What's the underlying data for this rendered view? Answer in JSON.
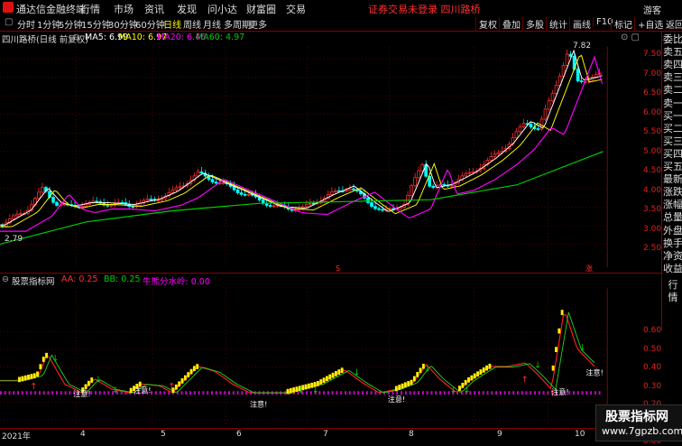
{
  "app": {
    "name": "通达信金融终端",
    "menu": [
      "行情",
      "市场",
      "资讯",
      "发现",
      "问小达",
      "财富圈",
      "交易"
    ],
    "notice": "证券交易未登录  四川路桥",
    "guest": "游客"
  },
  "toolbar": {
    "periods": [
      "分时",
      "1分钟",
      "5分钟",
      "15分钟",
      "30分钟",
      "60分钟",
      "日线",
      "周线",
      "月线",
      "多周期",
      "更多"
    ],
    "active": "日线",
    "right": [
      "复权",
      "叠加",
      "多股",
      "统计",
      "画线",
      "F10",
      "标记",
      "+自选",
      "返回"
    ]
  },
  "info": {
    "stock": "四川路桥(日线 前复权)",
    "ma5": "MA5: 6.99",
    "ma10": "MA10: 6.97",
    "ma20": "MA20: 6.46",
    "ma60": "MA60: 4.97"
  },
  "colors": {
    "ma5": "#ffffff",
    "ma10": "#ffff00",
    "ma20": "#ff00ff",
    "ma60": "#00cc00",
    "up": "#ff3030",
    "down": "#00ffff"
  },
  "upper_axis": [
    "7.50",
    "7.00",
    "6.50",
    "6.00",
    "5.50",
    "5.00",
    "4.50",
    "4.00",
    "3.50",
    "3.00",
    "2.50"
  ],
  "price_labels": {
    "high": "7.82",
    "low": "2.79"
  },
  "right_panel": [
    "委比",
    "卖五",
    "卖四",
    "卖三",
    "卖二",
    "卖一",
    "买一",
    "买二",
    "买三",
    "买四",
    "买五",
    "最新",
    "涨跌",
    "涨幅",
    "总量",
    "外盘",
    "换手",
    "净资",
    "收益"
  ],
  "right_panel2": [
    "行",
    "情"
  ],
  "indicator": {
    "name": "股票指标网",
    "aa": "AA: 0.25",
    "bb": "BB: 0.25",
    "water": "牛熊分水岭: 0.00"
  },
  "lower_axis": [
    "0.60",
    "0.50",
    "0.40",
    "0.30",
    "0.20",
    "0.10",
    "0.00"
  ],
  "dates": [
    "2021年",
    "4",
    "5",
    "6",
    "7",
    "8",
    "9",
    "10"
  ],
  "markers": {
    "note": "注意!",
    "s": "S",
    "b": "涨"
  },
  "watermark": {
    "line1": "股票指标网",
    "line2": "www.7gpzb.com"
  }
}
